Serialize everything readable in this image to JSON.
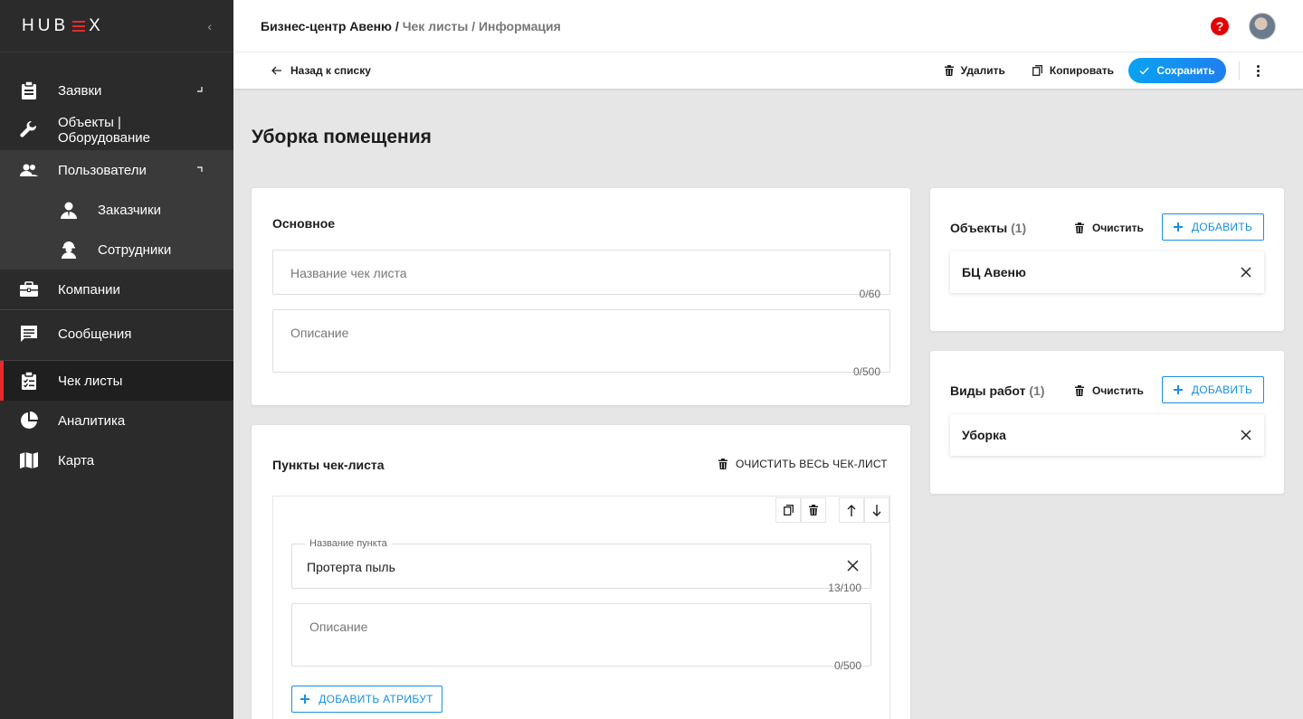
{
  "app": {
    "logo_left": "HU",
    "logo_mid": "B",
    "logo_x": "☰",
    "logo_right": "X",
    "accent": "#e52b2b",
    "blue": "#1a8fe3"
  },
  "sidebar": {
    "items": [
      {
        "label": "Заявки",
        "icon": "clipboard-icon"
      },
      {
        "label": "Объекты | Оборудование",
        "icon": "wrench-icon"
      },
      {
        "label": "Пользователи",
        "icon": "users-icon"
      },
      {
        "label": "Заказчики",
        "icon": "customer-icon"
      },
      {
        "label": "Сотрудники",
        "icon": "worker-icon"
      },
      {
        "label": "Компании",
        "icon": "briefcase-icon"
      },
      {
        "label": "Сообщения",
        "icon": "message-icon"
      },
      {
        "label": "Чек листы",
        "icon": "checklist-icon"
      },
      {
        "label": "Аналитика",
        "icon": "pie-chart-icon"
      },
      {
        "label": "Карта",
        "icon": "map-icon"
      }
    ]
  },
  "header": {
    "crumb_main": "Бизнес-центр Авеню",
    "crumb_sep": " / ",
    "crumb_rest": "Чек листы / Информация",
    "help": "?"
  },
  "toolbar": {
    "back": "Назад к списку",
    "delete": "Удалить",
    "copy": "Копировать",
    "save": "Сохранить"
  },
  "page": {
    "title": "Уборка помещения"
  },
  "basic": {
    "title": "Основное",
    "name_placeholder": "Название чек листа",
    "name_counter": "0/60",
    "desc_placeholder": "Описание",
    "desc_counter": "0/500"
  },
  "points": {
    "title": "Пункты чек-листа",
    "clear_all": "ОЧИСТИТЬ ВЕСЬ ЧЕК-ЛИСТ",
    "item_label": "Название пункта",
    "item_value": "Протерта пыль",
    "item_counter": "13/100",
    "item_desc_placeholder": "Описание",
    "item_desc_counter": "0/500",
    "add_attribute": "ДОБАВИТЬ АТРИБУТ"
  },
  "objects": {
    "title": "Объекты",
    "count": "(1)",
    "clear": "Очистить",
    "add": "ДОБАВИТЬ",
    "items": [
      "БЦ Авеню"
    ]
  },
  "work_types": {
    "title": "Виды работ",
    "count": "(1)",
    "clear": "Очистить",
    "add": "ДОБАВИТЬ",
    "items": [
      "Уборка"
    ]
  }
}
